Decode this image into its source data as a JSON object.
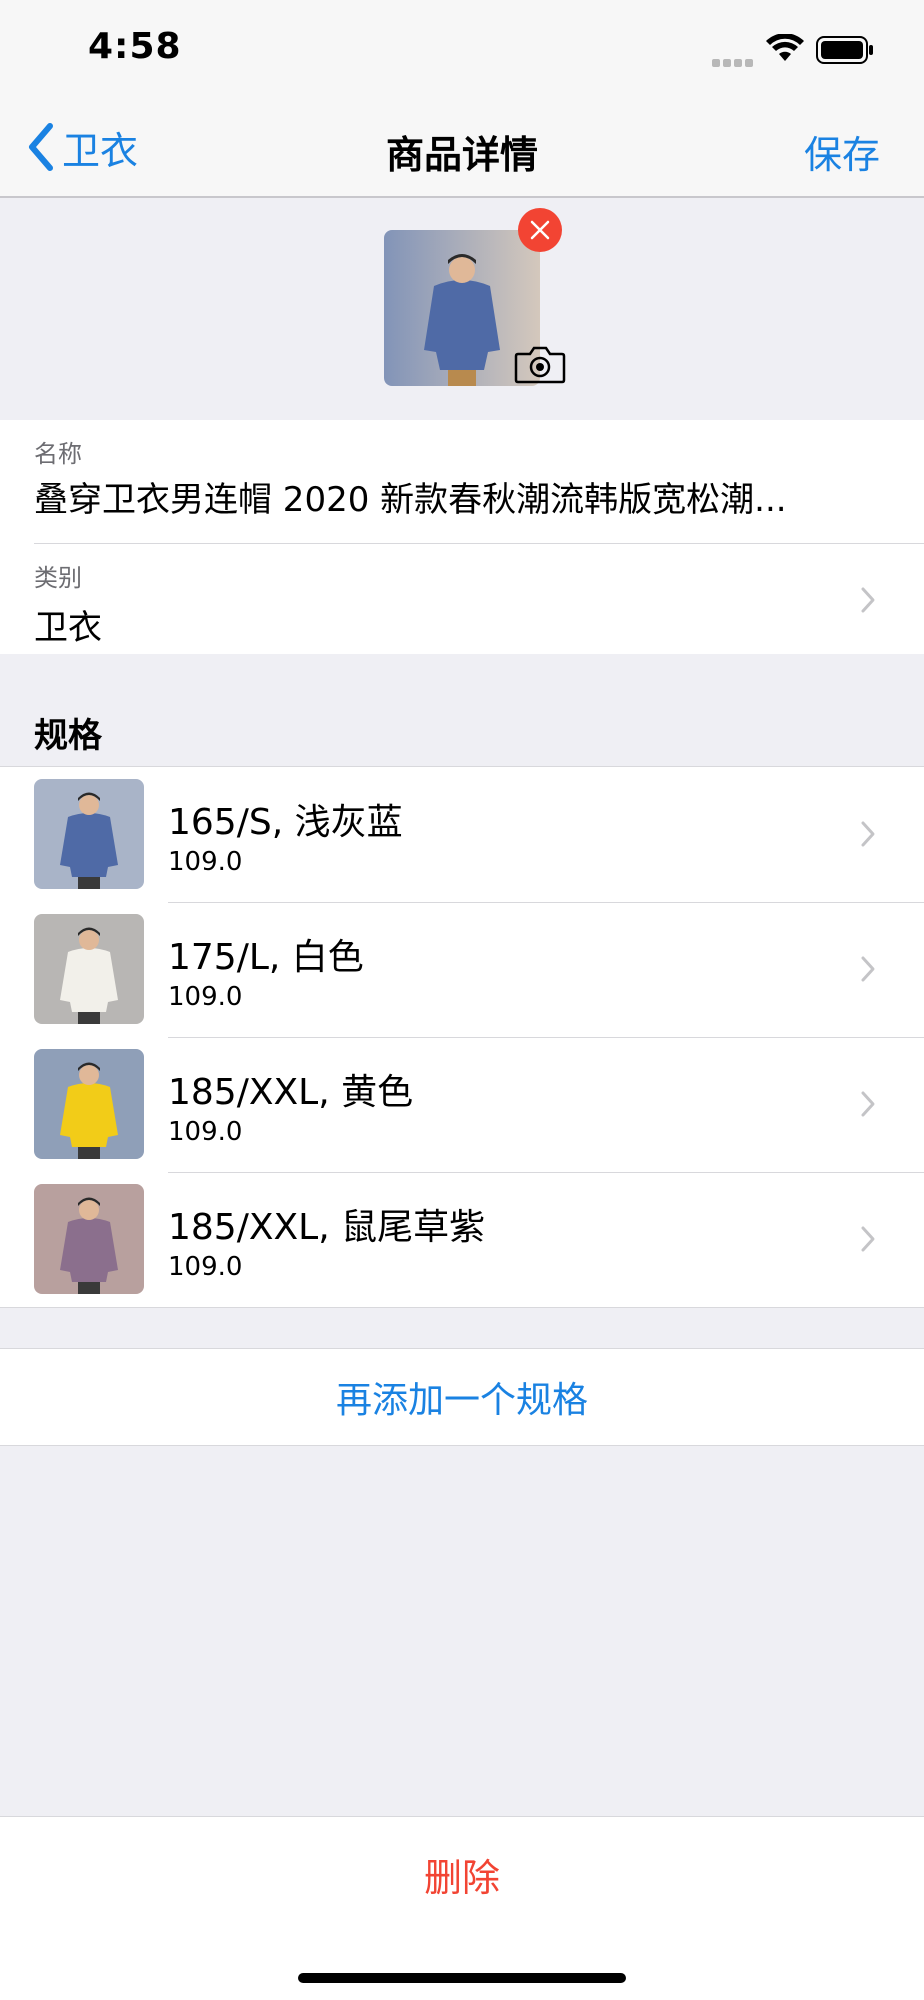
{
  "status_bar": {
    "time": "4:58"
  },
  "nav": {
    "back_label": "卫衣",
    "title": "商品详情",
    "save_label": "保存"
  },
  "form": {
    "name_label": "名称",
    "name_value": "叠穿卫衣男连帽 2020 新款春秋潮流韩版宽松潮...",
    "category_label": "类别",
    "category_value": "卫衣"
  },
  "spec_section": {
    "header": "规格",
    "items": [
      {
        "title": "165/S, 浅灰蓝",
        "price": "109.0",
        "hoodie_color": "#4f6aa6",
        "bg": "#a9b4c8"
      },
      {
        "title": "175/L, 白色",
        "price": "109.0",
        "hoodie_color": "#f2f0ea",
        "bg": "#b8b6b4"
      },
      {
        "title": "185/XXL, 黄色",
        "price": "109.0",
        "hoodie_color": "#f2cc18",
        "bg": "#8f9fb8"
      },
      {
        "title": "185/XXL, 鼠尾草紫",
        "price": "109.0",
        "hoodie_color": "#8b6f8d",
        "bg": "#b8a09e"
      }
    ],
    "add_label": "再添加一个规格"
  },
  "delete_label": "删除",
  "colors": {
    "accent": "#1a82e2",
    "destructive": "#f24433"
  },
  "icons": {
    "back": "chevron-left-icon",
    "remove": "close-circle-icon",
    "camera": "camera-icon",
    "disclosure": "chevron-right-icon",
    "wifi": "wifi-icon",
    "battery": "battery-icon"
  }
}
